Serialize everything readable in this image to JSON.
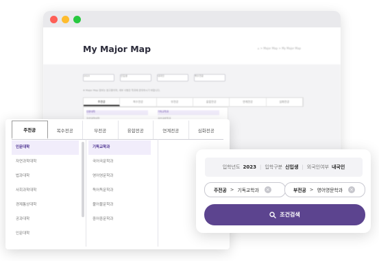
{
  "window": {
    "controls": [
      "close",
      "minimize",
      "maximize"
    ],
    "page_title": "My Major Map",
    "breadcrumb": [
      "⌂",
      "Major Map",
      "My Major Map"
    ],
    "filters": [
      "2023",
      "신입생",
      "내국인",
      "복수전공"
    ],
    "note": "※ Major Map 정보는 참고용이며, 세부 사항은 학과에 문의하시기 바랍니다.",
    "tabs": [
      "주전공",
      "복수전공",
      "부전공",
      "융합전공",
      "연계전공",
      "심화전공"
    ],
    "bg_colleges": [
      "인문대학",
      "자연과학대학",
      "법과대학"
    ],
    "bg_depts": [
      "기독교학과",
      "국어국문학과",
      "영어영문학과"
    ]
  },
  "major_map": {
    "tabs": [
      "주전공",
      "복수전공",
      "부전공",
      "융합전공",
      "연계전공",
      "심화전공"
    ],
    "active_tab": 0,
    "colleges": [
      "인문대학",
      "자연과학대학",
      "법과대학",
      "사회과학대학",
      "경제통상대학",
      "공과대학",
      "인문대학"
    ],
    "active_college": 0,
    "departments": [
      "기독교학과",
      "국어국문학과",
      "영어영문학과",
      "독어독문학과",
      "불어불문학과",
      "중어중문학과"
    ],
    "active_department": 0
  },
  "filter": {
    "info": [
      {
        "key": "입학년도",
        "value": "2023"
      },
      {
        "key": "입학구분",
        "value": "신입생"
      },
      {
        "key": "외국인여부",
        "value": "내국인"
      }
    ],
    "chips": [
      {
        "type": "주전공",
        "major": "기독교학과"
      },
      {
        "type": "부전공",
        "major": "영어영문학과"
      }
    ],
    "search_label": "조건검색",
    "accent": "#5c448f"
  }
}
